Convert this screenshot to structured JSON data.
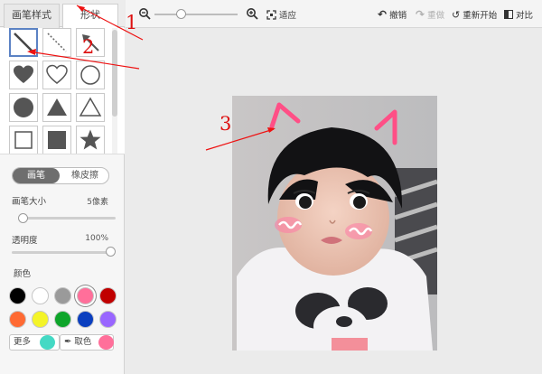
{
  "tabs": {
    "brush_style": "画笔样式",
    "shapes": "形状"
  },
  "shapes": [
    {
      "icon": "line-icon"
    },
    {
      "icon": "dashed-line-icon"
    },
    {
      "icon": "arrow-icon"
    },
    {
      "icon": "heart-filled-icon"
    },
    {
      "icon": "heart-outline-icon"
    },
    {
      "icon": "circle-outline-icon"
    },
    {
      "icon": "circle-filled-icon"
    },
    {
      "icon": "triangle-filled-icon"
    },
    {
      "icon": "triangle-outline-icon"
    },
    {
      "icon": "square-outline-icon"
    },
    {
      "icon": "square-filled-icon"
    },
    {
      "icon": "star-filled-icon"
    }
  ],
  "mode": {
    "brush": "画笔",
    "eraser": "橡皮擦"
  },
  "brush_size": {
    "label": "画笔大小",
    "value": "5像素",
    "level": 0.05
  },
  "opacity": {
    "label": "透明度",
    "value": "100%",
    "level": 1.0
  },
  "color_label": "颜色",
  "colors": {
    "row1": [
      "#000000",
      "#ffffff",
      "#9a9a9a",
      "#ff6f9a",
      "#c00000"
    ],
    "row2": [
      "#ff6a33",
      "#f4f428",
      "#0ea52a",
      "#0b3fbf",
      "#9966ff"
    ],
    "selected": "#ff6f9a",
    "more_color": "#44d9c4",
    "picked_color": "#ff6f9a"
  },
  "more_label": "更多",
  "picker_label": "取色",
  "toolbar": {
    "fit": "适应",
    "undo": "撤销",
    "redo": "重做",
    "restart": "重新开始",
    "compare": "对比"
  },
  "annotations": {
    "n1": "1",
    "n2": "2",
    "n3": "3"
  }
}
